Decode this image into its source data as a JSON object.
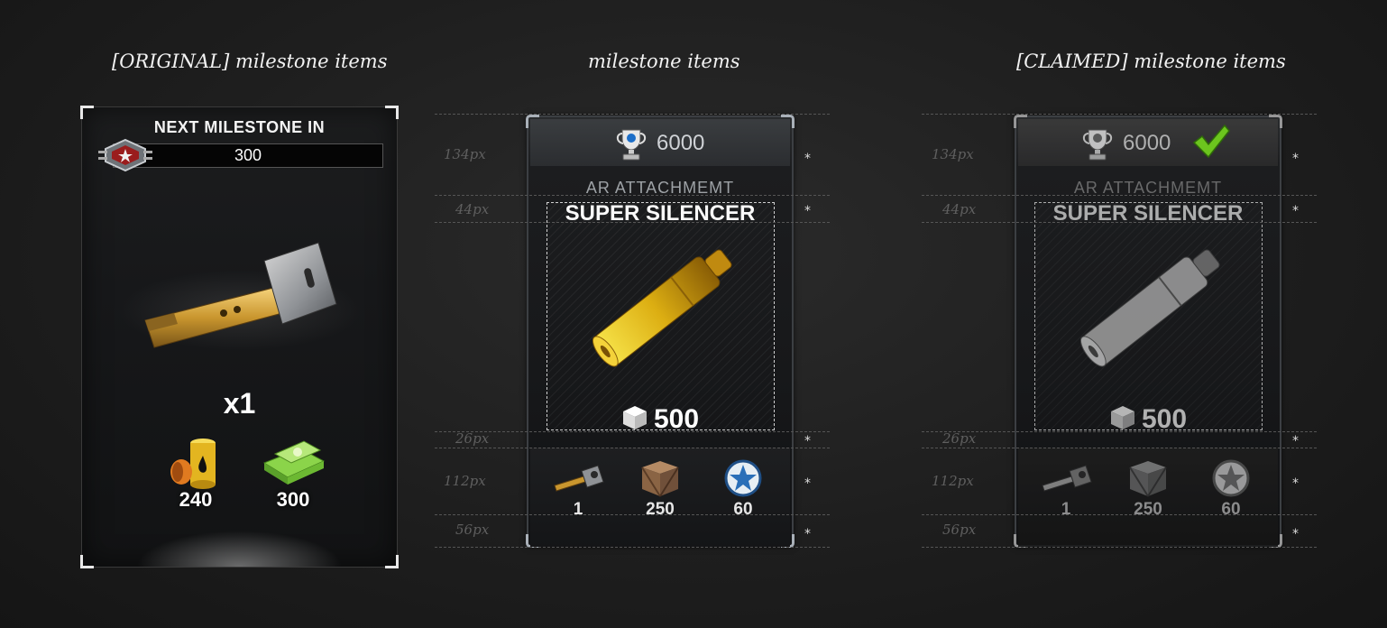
{
  "columns": {
    "original_title": "[ORIGINAL] milestone items",
    "milestone_title": "milestone items",
    "claimed_title": "[CLAIMED] milestone items"
  },
  "original": {
    "header": "NEXT MILESTONE IN",
    "progress_value": "300",
    "item_icon": "key-icon",
    "quantity": "x1",
    "rewards": [
      {
        "icon": "oil-barrel-icon",
        "value": "240"
      },
      {
        "icon": "cash-stack-icon",
        "value": "300"
      }
    ]
  },
  "milestone": {
    "points": "6000",
    "category": "AR ATTACHMEMT",
    "item_name": "SUPER SILENCER",
    "price": "500",
    "item_icon": "silencer-icon",
    "rewards": [
      {
        "icon": "key-icon",
        "value": "1"
      },
      {
        "icon": "crate-icon",
        "value": "250"
      },
      {
        "icon": "star-medal-icon",
        "value": "60"
      }
    ]
  },
  "claimed": {
    "points": "6000",
    "category": "AR ATTACHMEMT",
    "item_name": "SUPER SILENCER",
    "price": "500",
    "status_icon": "checkmark-icon",
    "rewards": [
      {
        "icon": "key-icon",
        "value": "1"
      },
      {
        "icon": "crate-icon",
        "value": "250"
      },
      {
        "icon": "star-medal-icon",
        "value": "60"
      }
    ]
  },
  "guides": {
    "labels": [
      "134px",
      "44px",
      "26px",
      "112px",
      "56px"
    ],
    "marker": "*"
  },
  "colors": {
    "gold": "#e0b81c",
    "check_green": "#6cc51e",
    "frame": "#a9b0b8"
  }
}
